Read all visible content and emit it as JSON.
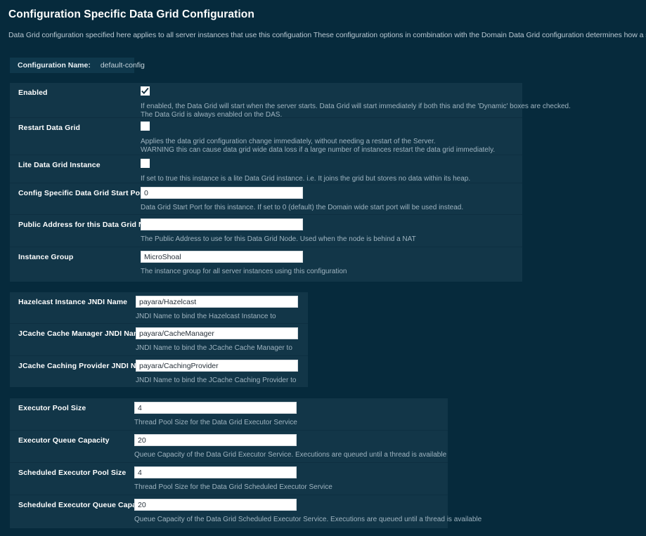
{
  "page": {
    "title": "Configuration Specific Data Grid Configuration",
    "description": "Data Grid configuration specified here applies to all server instances that use this configuation These configuration options in combination with the Domain Data Grid configuration determines how a server instance joins the data grid.",
    "config_label": "Configuration Name:",
    "config_value": "default-config"
  },
  "colors": {
    "background": "#062a3c",
    "panel": "#123648",
    "divider": "#0d2f41",
    "label": "#ffffff",
    "help": "#9fb4c0",
    "input_bg": "#ffffff",
    "input_text": "#27313a",
    "badge_bg": "#0f384c"
  },
  "groups": [
    {
      "name": "general",
      "rows": [
        {
          "label": "Enabled",
          "type": "checkbox",
          "checked": true,
          "help": [
            "If enabled, the Data Grid will start when the server starts. Data Grid will start immediately if both this and the 'Dynamic' boxes are checked.",
            "The Data Grid is always enabled on the DAS."
          ]
        },
        {
          "label": "Restart Data Grid",
          "type": "checkbox",
          "checked": false,
          "help": [
            "Applies the data grid configuration change immediately, without needing a restart of the Server.",
            "WARNING this can cause data grid wide data loss if a large number of instances restart the data grid immediately."
          ]
        },
        {
          "label": "Lite Data Grid Instance",
          "type": "checkbox",
          "checked": false,
          "help": [
            "If set to true this instance is a lite Data Grid instance. i.e. It joins the grid but stores no data within its heap."
          ]
        },
        {
          "label": "Config Specific Data Grid Start Port",
          "type": "text",
          "value": "0",
          "help": [
            "Data Grid Start Port for this instance. If set to 0 (default) the Domain wide start port will be used instead."
          ]
        },
        {
          "label": "Public Address for this Data Grid Node",
          "type": "text",
          "value": "",
          "help": [
            "The Public Address to use for this Data Grid Node. Used when the node is behind a NAT"
          ]
        },
        {
          "label": "Instance Group",
          "type": "text",
          "value": "MicroShoal",
          "help": [
            "The instance group for all server instances using this configuration"
          ]
        }
      ]
    },
    {
      "name": "jndi",
      "rows": [
        {
          "label": "Hazelcast Instance JNDI Name",
          "type": "text",
          "value": "payara/Hazelcast",
          "help": [
            "JNDI Name to bind the Hazelcast Instance to"
          ]
        },
        {
          "label": "JCache Cache Manager JNDI Name",
          "type": "text",
          "value": "payara/CacheManager",
          "help": [
            "JNDI Name to bind the JCache Cache Manager to"
          ]
        },
        {
          "label": "JCache Caching Provider JNDI Name",
          "type": "text",
          "value": "payara/CachingProvider",
          "help": [
            "JNDI Name to bind the JCache Caching Provider to"
          ]
        }
      ]
    },
    {
      "name": "executor",
      "rows": [
        {
          "label": "Executor Pool Size",
          "type": "text",
          "value": "4",
          "help": [
            "Thread Pool Size for the Data Grid Executor Service"
          ]
        },
        {
          "label": "Executor Queue Capacity",
          "type": "text",
          "value": "20",
          "help": [
            "Queue Capacity of the Data Grid Executor Service. Executions are queued until a thread is available"
          ]
        },
        {
          "label": "Scheduled Executor Pool Size",
          "type": "text",
          "value": "4",
          "help": [
            "Thread Pool Size for the Data Grid Scheduled Executor Service"
          ]
        },
        {
          "label": "Scheduled Executor Queue Capacity",
          "type": "text",
          "value": "20",
          "help": [
            "Queue Capacity of the Data Grid Scheduled Executor Service. Executions are queued until a thread is available"
          ]
        }
      ]
    }
  ]
}
